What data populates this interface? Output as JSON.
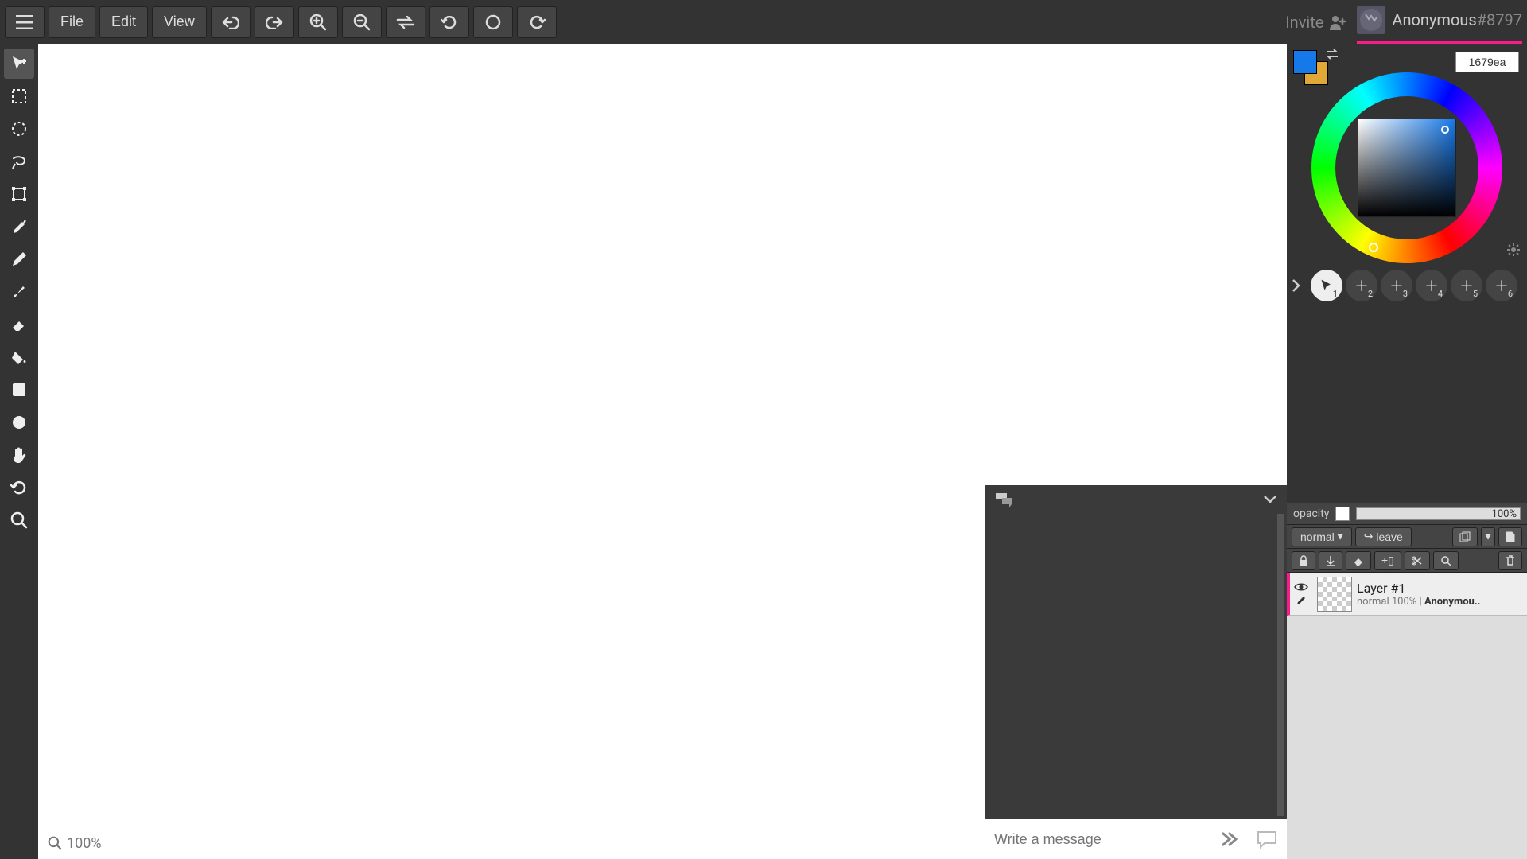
{
  "topbar": {
    "menu_file": "File",
    "menu_edit": "Edit",
    "menu_view": "View",
    "invite_label": "Invite",
    "username": "Anonymous",
    "userid": "#8797"
  },
  "hex_value": "1679ea",
  "primary_color": "#1679ea",
  "secondary_color": "#e2a837",
  "zoom_label": "100%",
  "chat": {
    "placeholder": "Write a message"
  },
  "opacity": {
    "label": "opacity",
    "value": "100%"
  },
  "blend_mode": "normal",
  "leave_label": "leave",
  "layer": {
    "name": "Layer #1",
    "sub_mode": "normal",
    "sub_opacity": "100%",
    "sub_owner": "Anonymou.."
  },
  "presets": [
    "1",
    "2",
    "3",
    "4",
    "5",
    "6"
  ]
}
